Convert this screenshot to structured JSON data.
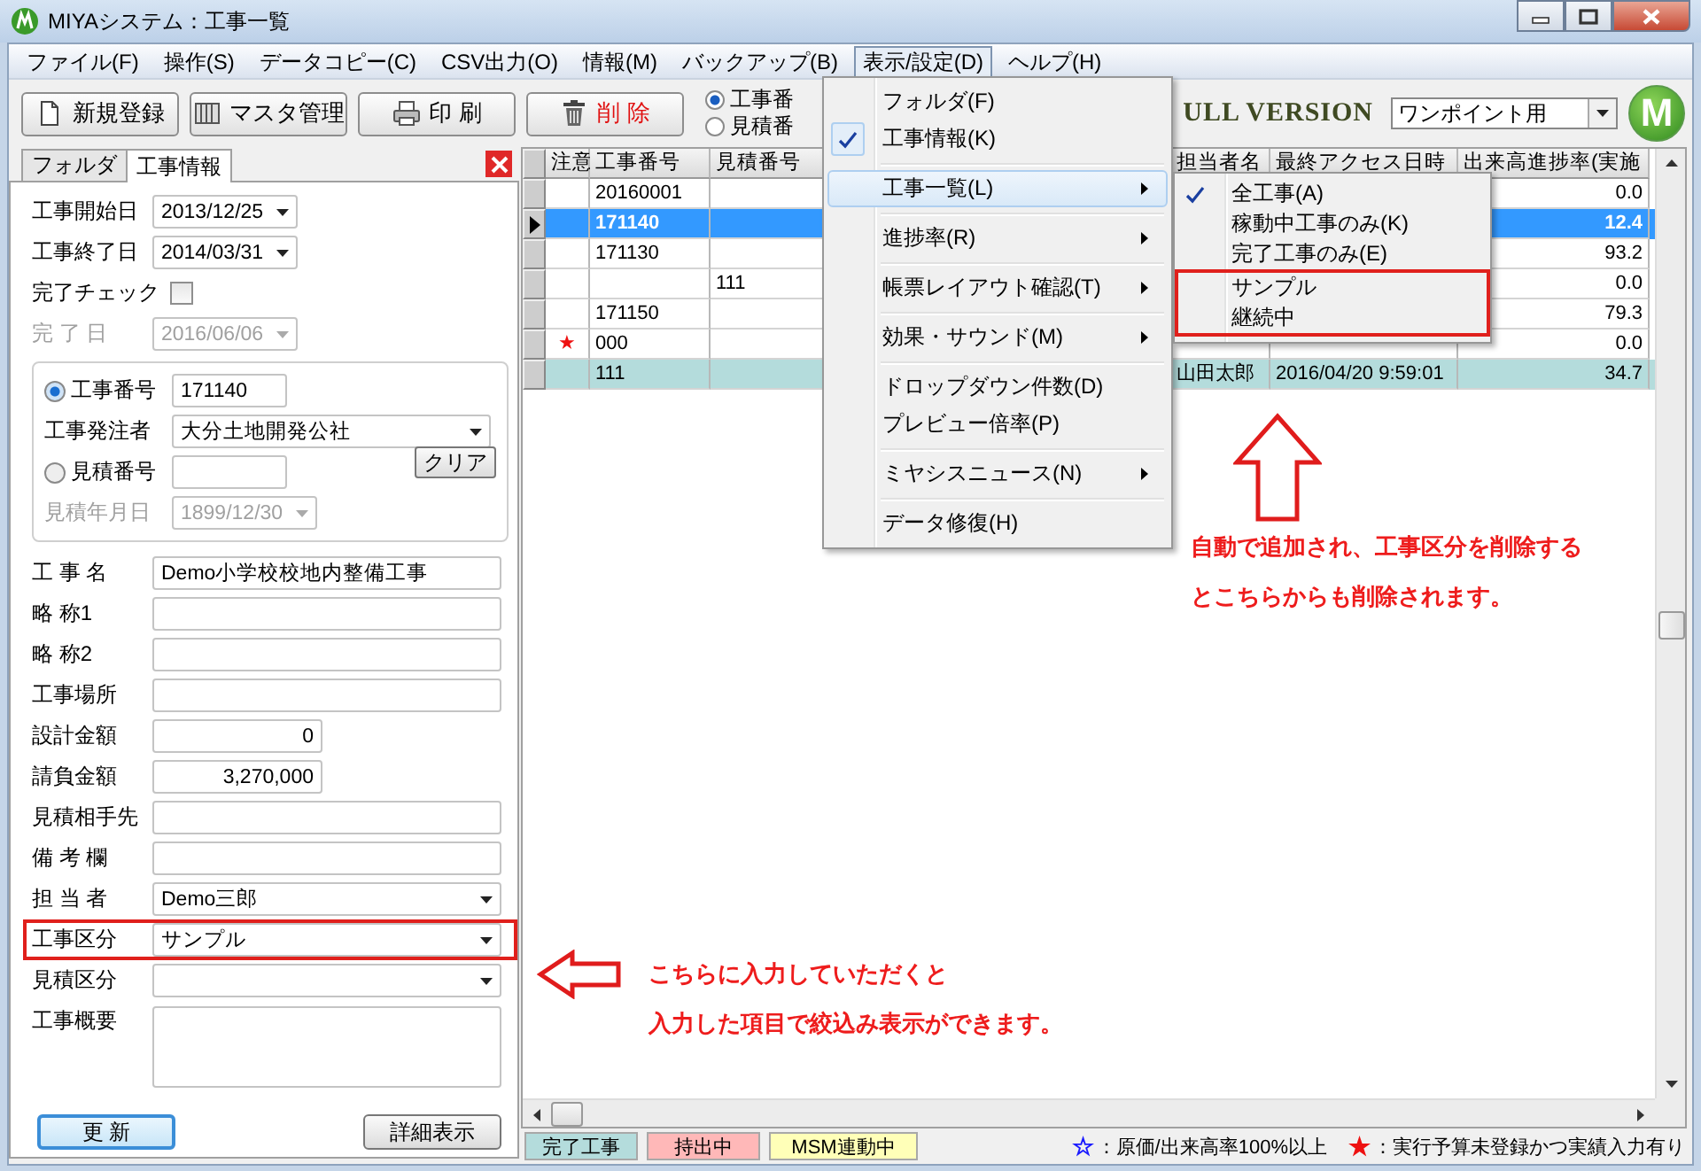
{
  "window": {
    "title": "MIYAシステム：工事一覧"
  },
  "menu_bar": [
    {
      "label": "ファイル(F)",
      "selected": false
    },
    {
      "label": "操作(S)",
      "selected": false
    },
    {
      "label": "データコピー(C)",
      "selected": false
    },
    {
      "label": "CSV出力(O)",
      "selected": false
    },
    {
      "label": "情報(M)",
      "selected": false
    },
    {
      "label": "バックアップ(B)",
      "selected": false
    },
    {
      "label": "表示/設定(D)",
      "selected": true
    },
    {
      "label": "ヘルプ(H)",
      "selected": false
    }
  ],
  "toolbar": {
    "buttons": [
      {
        "label": "新規登録",
        "kind": "new"
      },
      {
        "label": "マスタ管理",
        "kind": "master"
      },
      {
        "label": "印 刷",
        "kind": "print"
      },
      {
        "label": "削 除",
        "kind": "delete"
      }
    ],
    "search_mode": [
      {
        "label": "工事番",
        "selected": true
      },
      {
        "label": "見積番",
        "selected": false
      }
    ],
    "edition": "ULL VERSION",
    "view_select": "ワンポイント用",
    "logo": "M"
  },
  "view_menu": {
    "groups": [
      [
        {
          "label": "フォルダ(F)",
          "checked": false,
          "selected": false,
          "submenu": false
        },
        {
          "label": "工事情報(K)",
          "checked": true,
          "selected": false,
          "submenu": false
        }
      ],
      [
        {
          "label": "工事一覧(L)",
          "checked": false,
          "selected": true,
          "submenu": true,
          "items": [
            {
              "label": "全工事(A)",
              "checked": true,
              "highlighted": false
            },
            {
              "label": "稼動中工事のみ(K)",
              "checked": false,
              "highlighted": false
            },
            {
              "label": "完了工事のみ(E)",
              "checked": false,
              "highlighted": false
            },
            {
              "label": "サンプル",
              "checked": false,
              "highlighted": true
            },
            {
              "label": "継続中",
              "checked": false,
              "highlighted": true
            }
          ]
        }
      ],
      [
        {
          "label": "進捗率(R)",
          "checked": false,
          "selected": false,
          "submenu": true
        }
      ],
      [
        {
          "label": "帳票レイアウト確認(T)",
          "checked": false,
          "selected": false,
          "submenu": true
        }
      ],
      [
        {
          "label": "効果・サウンド(M)",
          "checked": false,
          "selected": false,
          "submenu": true
        }
      ],
      [
        {
          "label": "ドロップダウン件数(D)",
          "checked": false,
          "selected": false,
          "submenu": false
        },
        {
          "label": "プレビュー倍率(P)",
          "checked": false,
          "selected": false,
          "submenu": false
        }
      ],
      [
        {
          "label": "ミヤシスニュース(N)",
          "checked": false,
          "selected": false,
          "submenu": true
        }
      ],
      [
        {
          "label": "データ修復(H)",
          "checked": false,
          "selected": false,
          "submenu": false
        }
      ]
    ]
  },
  "form": {
    "tabs": [
      {
        "label": "フォルダ",
        "selected": false
      },
      {
        "label": "工事情報",
        "selected": true
      }
    ],
    "fields": [
      {
        "kind": "date",
        "label": "工事開始日",
        "value": "2013/12/25",
        "disabled": false,
        "highlighted": false
      },
      {
        "kind": "date",
        "label": "工事終了日",
        "value": "2014/03/31",
        "disabled": false,
        "highlighted": false
      },
      {
        "kind": "checkbox",
        "label": "完了チェック",
        "checked": false,
        "highlighted": false
      },
      {
        "kind": "date",
        "label": "完 了 日",
        "value": "2016/06/06",
        "disabled": true,
        "highlighted": false
      },
      {
        "kind": "group",
        "highlighted": false,
        "fields": [
          {
            "kind": "radio",
            "label": "工事番号",
            "value": "171140",
            "selected": true
          },
          {
            "kind": "select",
            "label": "工事発注者",
            "value": "大分土地開発公社"
          },
          {
            "kind": "radio",
            "label": "見積番号",
            "selected": false,
            "action": "クリア"
          },
          {
            "kind": "date",
            "label": "見積年月日",
            "value": "1899/12/30",
            "disabled": true
          }
        ]
      },
      {
        "kind": "text",
        "label": "工 事 名",
        "value": "Demo小学校校地内整備工事",
        "highlighted": false
      },
      {
        "kind": "text",
        "label": "略 称1",
        "highlighted": false
      },
      {
        "kind": "text",
        "label": "略 称2",
        "highlighted": false
      },
      {
        "kind": "text",
        "label": "工事場所",
        "highlighted": false
      },
      {
        "kind": "number",
        "label": "設計金額",
        "value": "0",
        "highlighted": false
      },
      {
        "kind": "number",
        "label": "請負金額",
        "value": "3,270,000",
        "highlighted": false
      },
      {
        "kind": "text",
        "label": "見積相手先",
        "highlighted": false
      },
      {
        "kind": "text",
        "label": "備 考 欄",
        "highlighted": false
      },
      {
        "kind": "select",
        "label": "担 当 者",
        "value": "Demo三郎",
        "highlighted": false
      },
      {
        "kind": "select",
        "label": "工事区分",
        "value": "サンプル",
        "highlighted": true
      },
      {
        "kind": "select",
        "label": "見積区分",
        "highlighted": false
      },
      {
        "kind": "textarea",
        "label": "工事概要",
        "highlighted": false
      }
    ],
    "buttons": [
      {
        "label": "更 新",
        "kind": "primary"
      },
      {
        "label": "詳細表示",
        "kind": "normal"
      }
    ]
  },
  "table": {
    "columns": [
      "注意",
      "工事番号",
      "見積番号",
      "担当者名",
      "最終アクセス日時",
      "出来高進捗率(実施"
    ],
    "rows": [
      {
        "cells": [
          null,
          "20160001",
          null,
          null,
          null,
          "0.0"
        ],
        "selected": false,
        "kind": "normal"
      },
      {
        "cells": [
          null,
          "171140",
          null,
          null,
          null,
          "12.4"
        ],
        "selected": true,
        "kind": "normal"
      },
      {
        "cells": [
          null,
          "171130",
          null,
          null,
          null,
          "93.2"
        ],
        "selected": false,
        "kind": "normal"
      },
      {
        "cells": [
          null,
          null,
          "111",
          null,
          null,
          "0.0"
        ],
        "selected": false,
        "kind": "normal"
      },
      {
        "cells": [
          null,
          "171150",
          null,
          null,
          null,
          "79.3"
        ],
        "selected": false,
        "kind": "normal"
      },
      {
        "cells": [
          "★",
          "000",
          null,
          null,
          null,
          "0.0"
        ],
        "selected": false,
        "kind": "normal"
      },
      {
        "cells": [
          null,
          "111",
          null,
          "山田太郎",
          "2016/04/20 9:59:01",
          "34.7"
        ],
        "selected": false,
        "kind": "completed"
      }
    ]
  },
  "status_bar": {
    "chips": [
      {
        "label": "完了工事",
        "color": "#b4dcdc"
      },
      {
        "label": "持出中",
        "color": "#ffb8b8"
      },
      {
        "label": "MSM連動中",
        "color": "#ffffb8"
      }
    ],
    "marks": [
      {
        "symbol": "☆",
        "color": "#1a1aff",
        "text": "：原価/出来高率100%以上"
      },
      {
        "symbol": "★",
        "color": "#ee1111",
        "text": "：実行予算未登録かつ実績入力有り"
      }
    ]
  },
  "notes": [
    {
      "kind": "up",
      "lines": [
        "自動で追加され、工事区分を削除する",
        "とこちらからも削除されます。"
      ]
    },
    {
      "kind": "left",
      "lines": [
        "こちらに入力していただくと",
        "入力した項目で絞込み表示ができます。"
      ]
    }
  ]
}
